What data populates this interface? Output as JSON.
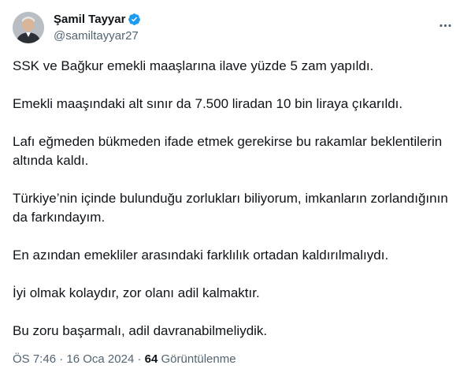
{
  "author": {
    "display_name": "Şamil Tayyar",
    "handle": "@samiltayyar27",
    "verified": true
  },
  "tweet": {
    "paragraphs": [
      "SSK ve Bağkur emekli maaşlarına ilave yüzde 5 zam yapıldı.",
      "Emekli maaşındaki alt sınır da 7.500 liradan 10 bin liraya çıkarıldı.",
      "Lafı eğmeden bükmeden ifade etmek gerekirse bu rakamlar beklentilerin altında kaldı.",
      "Türkiye’nin içinde bulunduğu zorlukları biliyorum, imkanların zorlandığının da farkındayım.",
      "En azından emekliler arasındaki farklılık ortadan kaldırılmalıydı.",
      "İyi olmak kolaydır, zor olanı adil kalmaktır.",
      "Bu zoru başarmalı, adil davranabilmeliydik."
    ],
    "time": "ÖS 7:46",
    "separator": "·",
    "date": "16 Oca 2024",
    "views_count": "64",
    "views_label": "Görüntülenme"
  },
  "icons": {
    "more": "more-options-icon",
    "verified": "verified-badge-icon"
  },
  "colors": {
    "text": "#0f1419",
    "secondary": "#536471",
    "verified": "#1d9bf0"
  }
}
